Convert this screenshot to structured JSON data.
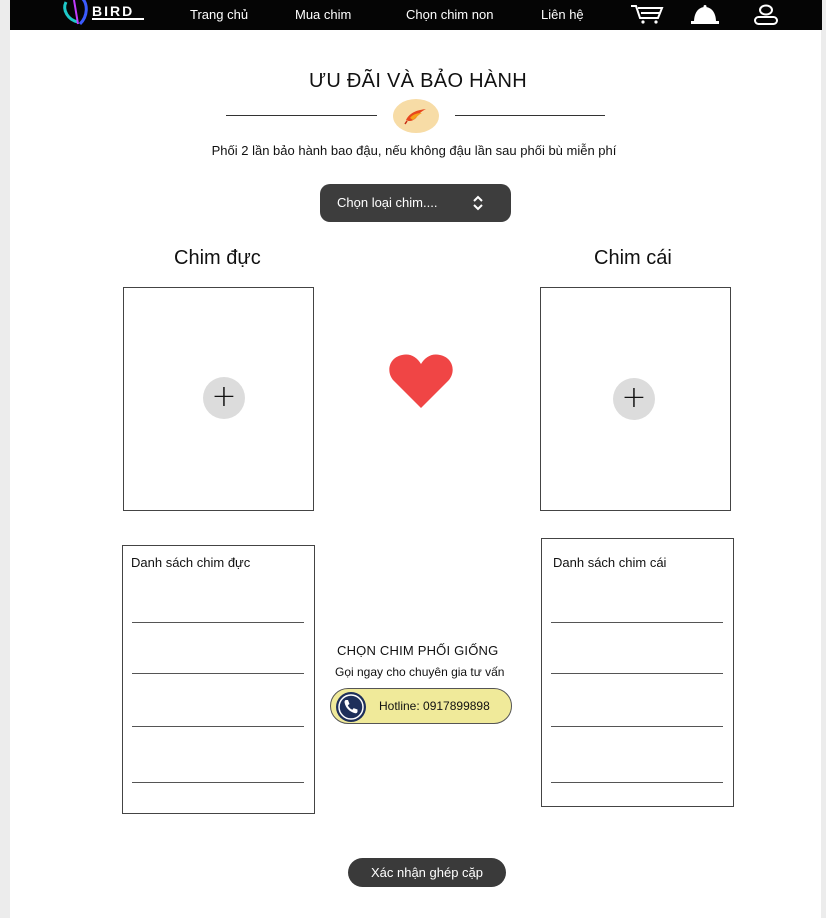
{
  "nav": {
    "logo_text": "BIRD",
    "links": [
      "Trang chủ",
      "Mua chim",
      "Chọn chim non",
      "Liên hệ"
    ],
    "icons": [
      "cart-icon",
      "bell-icon",
      "user-icon"
    ]
  },
  "header": {
    "title": "ƯU ĐÃI VÀ BẢO HÀNH",
    "badge_icon": "bird-icon",
    "subtitle": "Phối 2 lần bảo hành bao đậu, nếu không đậu lần sau phối bù miễn phí"
  },
  "selector": {
    "value": "Chọn loại chim....",
    "icon": "chevron-up-down-icon"
  },
  "male": {
    "title": "Chim đực",
    "list_title": "Danh sách chim đực"
  },
  "female": {
    "title": "Chim cái",
    "list_title": "Danh sách chim cái"
  },
  "center": {
    "heart_icon": "heart-icon",
    "heart_color": "#f04545",
    "cta_title": "CHỌN CHIM PHỐI GIỐNG",
    "cta_sub": "Gọi ngay cho chuyên gia tư vấn",
    "hotline": "Hotline: 0917899898"
  },
  "confirm_label": "Xác nhận ghép cặp",
  "colors": {
    "nav_bg": "#050505",
    "hotline_bg": "#f0ea9a",
    "dark_button": "#3a3a3a",
    "badge_bg": "#f7dca6"
  }
}
